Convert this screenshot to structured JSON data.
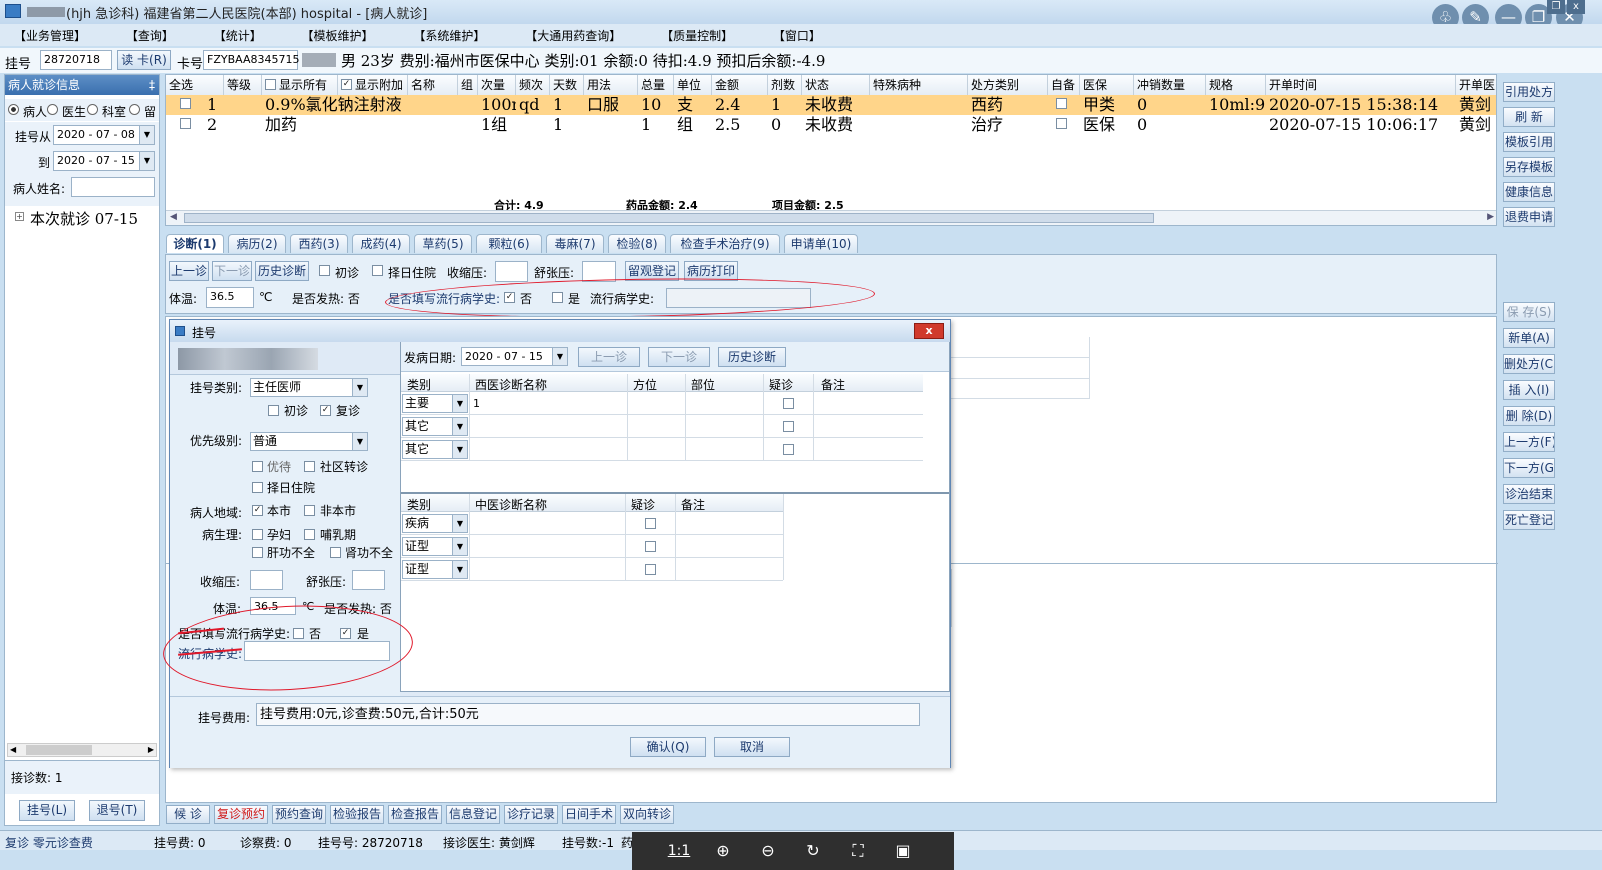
{
  "window": {
    "title": "(hjh 急诊科) 福建省第二人民医院(本部) hospital - [病人就诊]"
  },
  "menu": [
    "【业务管理】",
    "【查询】",
    "【统计】",
    "【模板维护】",
    "【系统维护】",
    "【大通用药查询】",
    "【质量控制】",
    "【窗口】"
  ],
  "patient_bar": {
    "reg_label": "挂号",
    "reg_value": "28720718",
    "read_card": "读 卡(R)",
    "card_label": "卡号",
    "card_value": "FZYBAA8345715",
    "info": "男  23岁  费别:福州市医保中心  类别:01  余额:0  待扣:4.9  预扣后余额:-4.9"
  },
  "left": {
    "title": "病人就诊信息",
    "pin": "‡",
    "radios": [
      "病人",
      "医生",
      "科室",
      "留"
    ],
    "from_label": "挂号从",
    "from_value": "2020 - 07 - 08",
    "to_label": "到",
    "to_value": "2020 - 07 - 15",
    "name_label": "病人姓名:",
    "tree_item": "本次就诊  07-15",
    "count": "接诊数: 1",
    "reg_btn": "挂号(L)",
    "return_btn": "退号(T)"
  },
  "grid": {
    "headers": [
      "全选",
      "等级",
      "显示所有",
      "显示附加",
      "名称",
      "组",
      "次量",
      "频次",
      "天数",
      "用法",
      "总量",
      "单位",
      "金额",
      "剂数",
      "状态",
      "特殊病种",
      "处方类别",
      "自备",
      "医保",
      "冲销数量",
      "规格",
      "开单时间",
      "开单医"
    ],
    "rows": [
      [
        "1",
        "0.9%氯化钠注射液",
        "100ml",
        "qd",
        "1",
        "口服",
        "10",
        "支",
        "2.4",
        "1",
        "未收费",
        "西药",
        "甲类",
        "0",
        "10ml:9(",
        "2020-07-15 15:38:14",
        "黄剑"
      ],
      [
        "2",
        "加药",
        "1组",
        "",
        "1",
        "",
        "1",
        "组",
        "2.5",
        "0",
        "未收费",
        "治疗",
        "医保",
        "0",
        "",
        "2020-07-15 10:06:17",
        "黄剑"
      ]
    ],
    "totals": {
      "sum": "合计: 4.9",
      "drug": "药品金额: 2.4",
      "item": "项目金额: 2.5"
    }
  },
  "tabs": [
    "诊断(1)",
    "病历(2)",
    "西药(3)",
    "成药(4)",
    "草药(5)",
    "颗粒(6)",
    "毒麻(7)",
    "检验(8)",
    "检查手术治疗(9)",
    "申请单(10)"
  ],
  "toolbar": {
    "prev": "上一诊",
    "next": "下一诊",
    "history": "历史诊断",
    "first": "初诊",
    "choose_hosp": "择日住院",
    "sys_label": "收缩压:",
    "dia_label": "舒张压:",
    "observe": "留观登记",
    "print": "病历打印",
    "temp_label": "体温:",
    "temp_value": "36.5",
    "temp_unit": "℃",
    "fever_label": "是否发热: 否",
    "epi_q": "是否填写流行病学史:",
    "no": "否",
    "yes": "是",
    "epi_history": "流行病学史:"
  },
  "right": [
    "引用处方",
    "刷 新",
    "模板引用",
    "另存模板",
    "健康信息",
    "退费申请",
    "保 存(S)",
    "新单(A)",
    "删处方(C)",
    "插 入(I)",
    "删 除(D)",
    "上一方(F)",
    "下一方(G)",
    "诊治结束",
    "死亡登记"
  ],
  "bottom_tabs": [
    "候 诊",
    "复诊预约",
    "预约查询",
    "检验报告",
    "检查报告",
    "信息登记",
    "诊疗记录",
    "日间手术",
    "双向转诊"
  ],
  "status": {
    "left": "复诊 零元诊查费",
    "reg_fee": "挂号费: 0",
    "exam_fee": "诊察费: 0",
    "reg_no": "挂号号: 28720718",
    "doctor": "接诊医生: 黄剑辉",
    "reg_count": "挂号数:-1",
    "drug": "药"
  },
  "viewer": {
    "ratio": "1:1"
  },
  "dialog": {
    "title": "挂号",
    "close": "x",
    "reg_type_label": "挂号类别:",
    "reg_type": "主任医师",
    "first": "初诊",
    "revisit": "复诊",
    "priority_label": "优先级别:",
    "priority": "普通",
    "priority_wait": "优待",
    "community": "社区转诊",
    "choose_hosp": "择日住院",
    "area_label": "病人地域:",
    "local": "本市",
    "nonlocal": "非本市",
    "phys_label": "病生理:",
    "pregnant": "孕妇",
    "lactation": "哺乳期",
    "liver": "肝功不全",
    "kidney": "肾功不全",
    "sys_label": "收缩压:",
    "dia_label": "舒张压:",
    "temp_label": "体温:",
    "temp_value": "36.5",
    "temp_unit": "℃",
    "fever": "是否发热: 否",
    "epi_q": "是否填写流行病学史:",
    "no": "否",
    "yes": "是",
    "epi_label": "流行病学史:",
    "onset_label": "发病日期:",
    "onset_value": "2020 - 07 - 15",
    "prev": "上一诊",
    "next": "下一诊",
    "history": "历史诊断",
    "west_headers": [
      "类别",
      "西医诊断名称",
      "方位",
      "部位",
      "疑诊",
      "备注"
    ],
    "west_rows": [
      [
        "主要",
        "1"
      ],
      [
        "其它",
        ""
      ],
      [
        "其它",
        ""
      ]
    ],
    "tcm_headers": [
      "类别",
      "中医诊断名称",
      "疑诊",
      "备注"
    ],
    "tcm_rows": [
      "疾病",
      "证型",
      "证型"
    ],
    "fee_label": "挂号费用:",
    "fee_value": "挂号费用:0元,诊查费:50元,合计:50元",
    "ok": "确认(Q)",
    "cancel": "取消"
  }
}
